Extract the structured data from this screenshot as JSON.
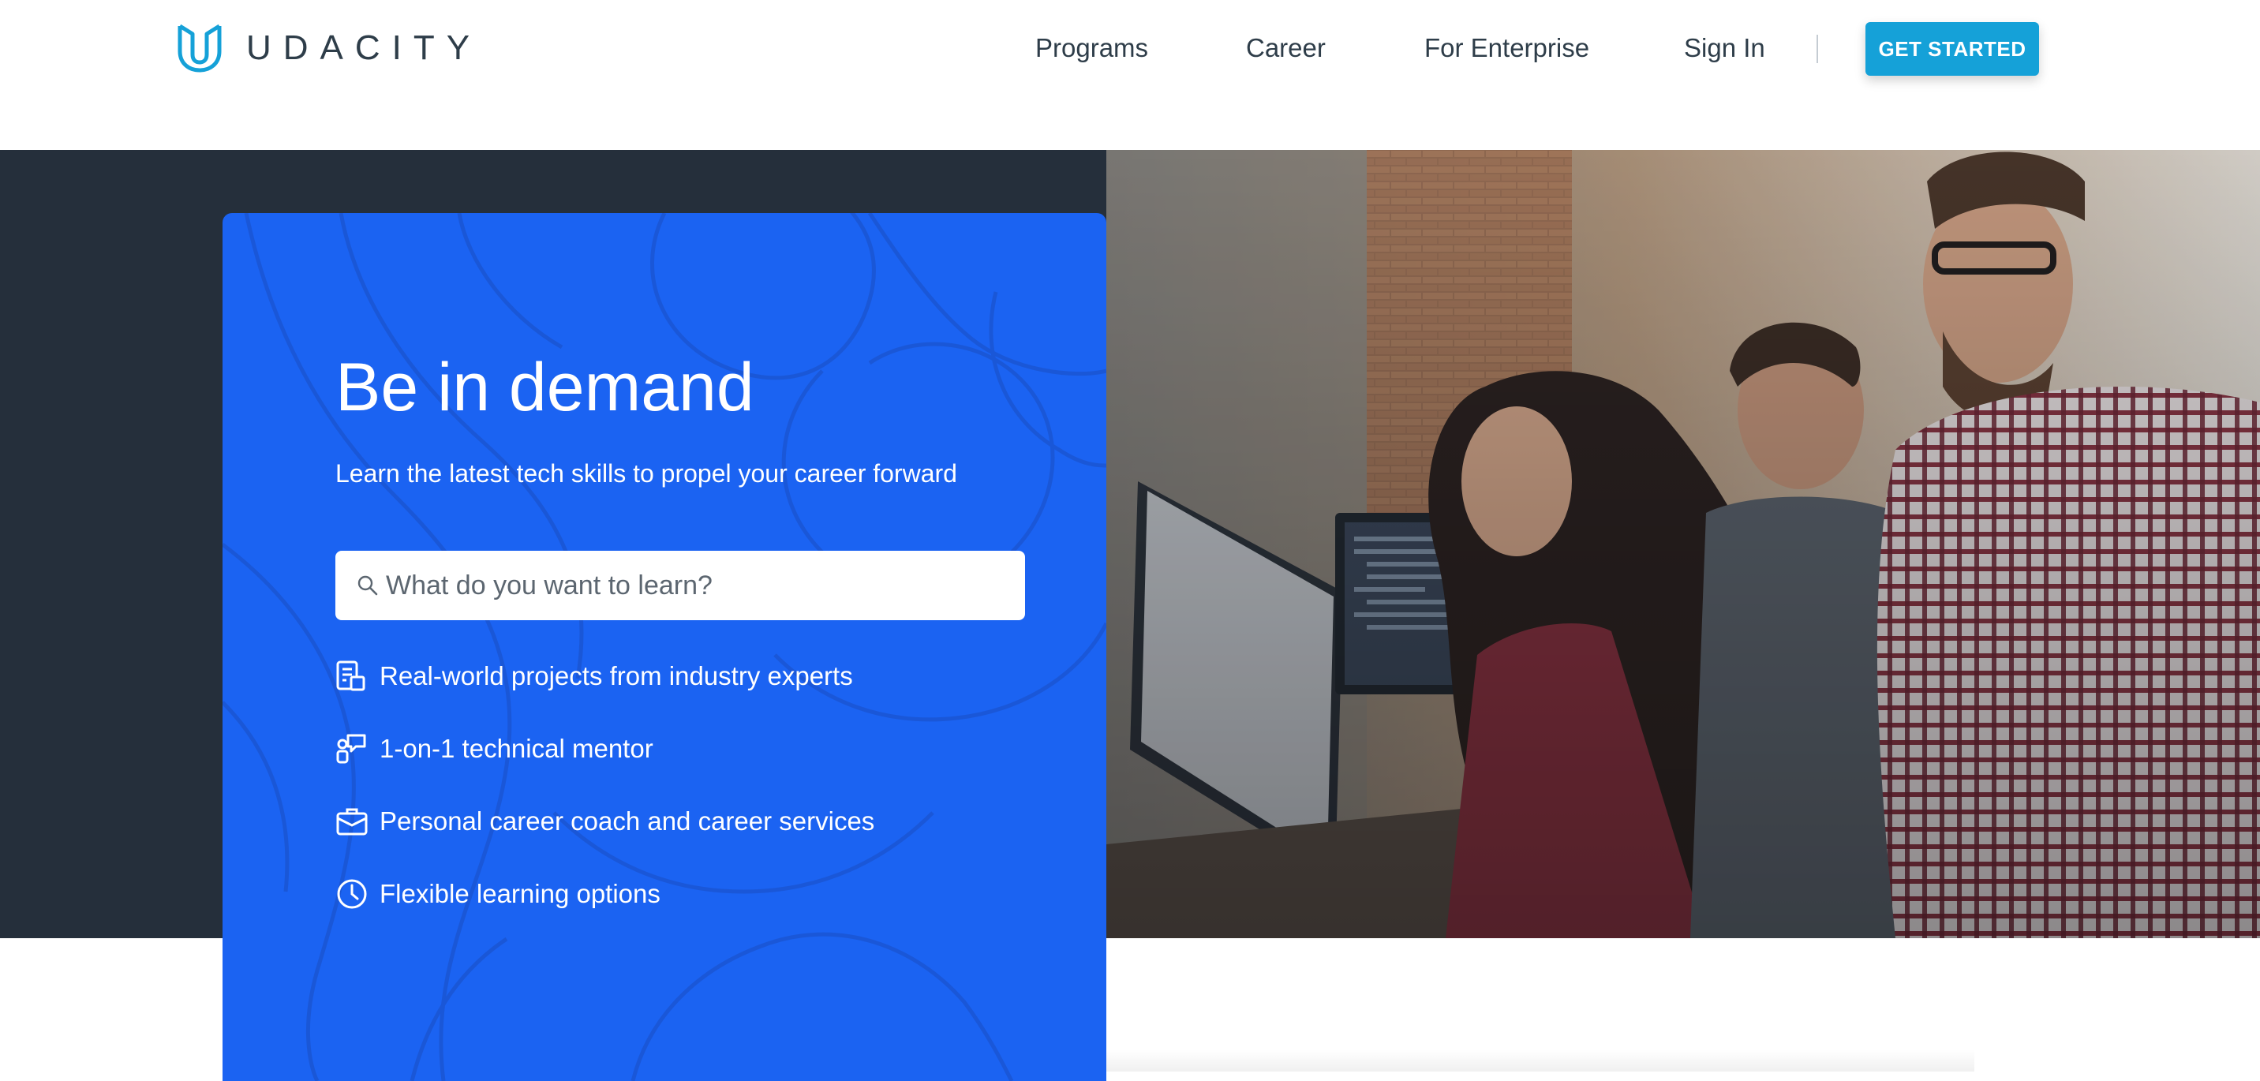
{
  "brand": {
    "name": "UDACITY",
    "accent": "#15a1d8",
    "card_color": "#1b63f2",
    "hero_background": "#252f3b"
  },
  "nav": {
    "links": [
      "Programs",
      "Career",
      "For Enterprise",
      "Sign In"
    ],
    "cta_label": "GET STARTED"
  },
  "hero": {
    "headline": "Be in demand",
    "subheadline": "Learn the latest tech skills to propel your career forward",
    "search": {
      "placeholder": "What do you want to learn?",
      "value": ""
    },
    "features": [
      {
        "icon": "project-icon",
        "label": "Real-world projects from industry experts"
      },
      {
        "icon": "mentor-icon",
        "label": "1-on-1 technical mentor"
      },
      {
        "icon": "briefcase-icon",
        "label": "Personal career coach and career services"
      },
      {
        "icon": "clock-icon",
        "label": "Flexible learning options"
      }
    ]
  }
}
